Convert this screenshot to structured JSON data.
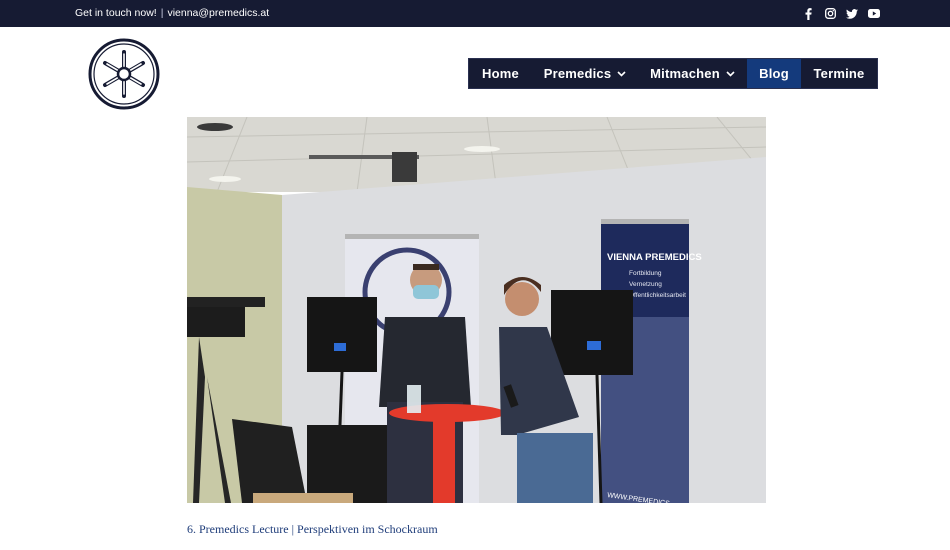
{
  "topbar": {
    "contact_label": "Get in touch now!",
    "separator": "|",
    "email": "vienna@premedics.at",
    "social_icons": [
      "facebook-icon",
      "instagram-icon",
      "twitter-icon",
      "youtube-icon"
    ]
  },
  "nav": {
    "items": [
      {
        "label": "Home",
        "has_dropdown": false
      },
      {
        "label": "Premedics",
        "has_dropdown": true
      },
      {
        "label": "Mitmachen",
        "has_dropdown": true
      },
      {
        "label": "Blog",
        "active": true
      },
      {
        "label": "Termine",
        "has_dropdown": false
      }
    ]
  },
  "photo": {
    "banner_title": "VIENNA PREMEDICS",
    "banner_lines": [
      "Fortbildung",
      "Vernetzung",
      "Öffentlichkeitsarbeit"
    ],
    "banner_footer": "WWW.PREMEDICS"
  },
  "post": {
    "caption": "6. Premedics Lecture | Perspektiven im Schockraum"
  },
  "colors": {
    "topbar_bg": "#161b33",
    "nav_bg": "#161b33",
    "nav_active_bg": "#143a7c",
    "caption_link": "#1f3d7a"
  }
}
